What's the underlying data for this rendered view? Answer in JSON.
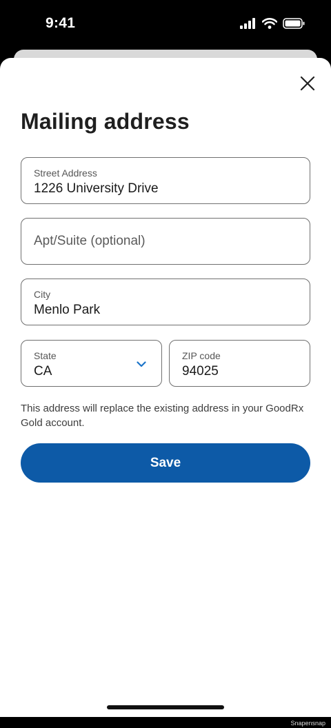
{
  "status_bar": {
    "time": "9:41",
    "icons": [
      "signal-icon",
      "wifi-icon",
      "battery-icon"
    ]
  },
  "sheet": {
    "title": "Mailing address",
    "close_icon": "close-icon"
  },
  "form": {
    "street": {
      "label": "Street Address",
      "value": "1226 University Drive"
    },
    "apt": {
      "placeholder": "Apt/Suite (optional)",
      "value": ""
    },
    "city": {
      "label": "City",
      "value": "Menlo Park"
    },
    "state": {
      "label": "State",
      "value": "CA",
      "icon": "chevron-down-icon"
    },
    "zip": {
      "label": "ZIP code",
      "value": "94025"
    }
  },
  "disclaimer": "This address will replace the existing address in your GoodRx Gold account.",
  "save_label": "Save",
  "watermark": "Snapensnap",
  "colors": {
    "primary_button": "#0d5aa7",
    "chevron": "#1a73c8",
    "field_border": "#6f6f6f"
  }
}
